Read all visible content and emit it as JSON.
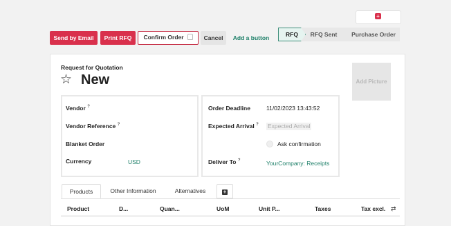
{
  "header": {
    "top_right_icon": "plus-square-icon"
  },
  "actions": {
    "send_by_email": "Send by Email",
    "print_rfq": "Print RFQ",
    "confirm_order": "Confirm Order",
    "cancel": "Cancel",
    "add_button": "Add a button"
  },
  "statusbar": {
    "stages": [
      "RFQ",
      "RFQ Sent",
      "Purchase Order"
    ],
    "active": "RFQ"
  },
  "form": {
    "subtitle": "Request for Quotation",
    "title": "New",
    "add_picture": "Add Picture",
    "left": {
      "vendor_label": "Vendor",
      "vendor_ref_label": "Vendor Reference",
      "blanket_order_label": "Blanket Order",
      "currency_label": "Currency",
      "currency_value": "USD",
      "tooltip_mark": "?"
    },
    "right": {
      "order_deadline_label": "Order Deadline",
      "order_deadline_value": "11/02/2023 13:43:52",
      "expected_arrival_label": "Expected Arrival",
      "expected_arrival_placeholder": "Expected Arrival",
      "ask_confirmation_label": "Ask confirmation",
      "deliver_to_label": "Deliver To",
      "deliver_to_value": "YourCompany: Receipts"
    }
  },
  "tabs": [
    "Products",
    "Other Information",
    "Alternatives"
  ],
  "tab_add_icon": "+",
  "table": {
    "columns": [
      "Product",
      "D...",
      "Quan...",
      "UoM",
      "Unit P...",
      "Taxes",
      "Tax excl."
    ],
    "settings_icon": "⇄"
  },
  "colors": {
    "primary": "#d9304c",
    "link": "#1d7f68"
  }
}
